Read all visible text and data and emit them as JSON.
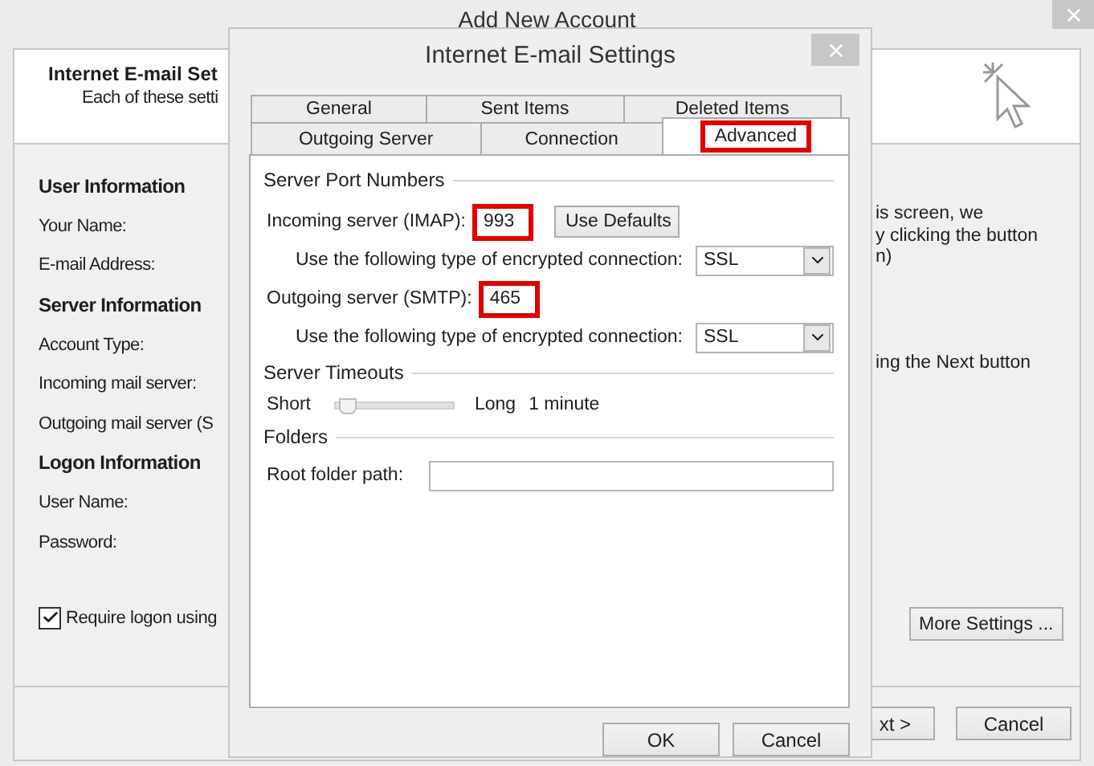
{
  "background_window": {
    "title": "Add New Account",
    "header_title": "Internet E-mail Set",
    "header_subtitle": "Each of these setti",
    "sections": [
      {
        "heading": "User Information",
        "fields": [
          "Your Name:",
          "E-mail Address:"
        ]
      },
      {
        "heading": "Server Information",
        "fields": [
          "Account Type:",
          "Incoming mail server:",
          "Outgoing mail server (S"
        ]
      },
      {
        "heading": "Logon Information",
        "fields": [
          "User Name:",
          "Password:"
        ]
      }
    ],
    "require_logon": {
      "label": "Require logon using",
      "checked": true
    },
    "description_lines": [
      "is screen, we",
      "y clicking the button",
      "n)"
    ],
    "next_hint": "ing the Next button",
    "more_settings": "More Settings ...",
    "buttons": [
      "xt >",
      "Cancel"
    ]
  },
  "dialog": {
    "title": "Internet E-mail Settings",
    "tab_rows": [
      [
        {
          "label": "General",
          "selected": false,
          "highlighted": false
        },
        {
          "label": "Sent Items",
          "selected": false,
          "highlighted": false
        },
        {
          "label": "Deleted Items",
          "selected": false,
          "highlighted": false
        }
      ],
      [
        {
          "label": "Outgoing Server",
          "selected": false,
          "highlighted": false
        },
        {
          "label": "Connection",
          "selected": false,
          "highlighted": false
        },
        {
          "label": "Advanced",
          "selected": true,
          "highlighted": true
        }
      ]
    ],
    "server_ports": {
      "heading": "Server Port Numbers",
      "incoming": {
        "label": "Incoming server (IMAP):",
        "value": "993",
        "highlighted": true
      },
      "use_defaults": "Use Defaults",
      "incoming_encryption": {
        "label": "Use the following type of encrypted connection:",
        "value": "SSL"
      },
      "outgoing": {
        "label": "Outgoing server (SMTP):",
        "value": "465",
        "highlighted": true
      },
      "outgoing_encryption": {
        "label": "Use the following type of encrypted connection:",
        "value": "SSL"
      }
    },
    "server_timeouts": {
      "heading": "Server Timeouts",
      "min_label": "Short",
      "max_label": "Long",
      "level": 0.05,
      "reading": "1 minute"
    },
    "folders": {
      "heading": "Folders",
      "root_label": "Root folder path:"
    },
    "buttons": [
      "OK",
      "Cancel"
    ]
  }
}
